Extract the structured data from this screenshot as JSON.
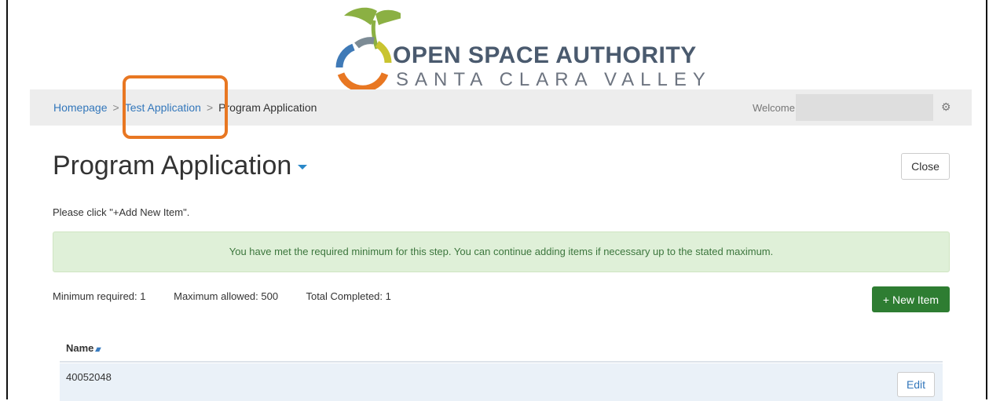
{
  "logo": {
    "line1": "OPEN SPACE AUTHORITY",
    "line2": "SANTA CLARA VALLEY",
    "colors": {
      "green": "#8bb043",
      "blue": "#3f7ab7",
      "orange": "#e87722",
      "gray": "#7c8b95",
      "yellow": "#c9c430"
    }
  },
  "breadcrumb": {
    "items": [
      "Homepage",
      "Test Application",
      "Program Application"
    ],
    "separator": ">"
  },
  "header": {
    "welcome_label": "Welcome",
    "settings_icon": "gear-icon"
  },
  "page": {
    "title": "Program Application",
    "close_label": "Close",
    "instruction": "Please click \"+Add New Item\".",
    "alert": "You have met the required minimum for this step. You can continue adding items if necessary up to the stated maximum.",
    "stats": {
      "min": "Minimum required: 1",
      "max": "Maximum allowed: 500",
      "completed": "Total Completed: 1"
    },
    "new_item_label": "+ New Item"
  },
  "table": {
    "columns": [
      "Name"
    ],
    "sort_icon": "sort-icon",
    "rows": [
      {
        "name": "40052048",
        "action": "Edit"
      }
    ]
  },
  "colors": {
    "highlight": "#e87722",
    "link": "#3377bb",
    "success_bg": "#dff0d8",
    "success_text": "#3c763d",
    "button_green": "#2e7d32"
  }
}
